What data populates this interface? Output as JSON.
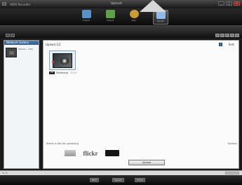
{
  "window": {
    "title": "Upload",
    "left_text": "HDRI Recorder",
    "controls": [
      "_",
      "□",
      "×"
    ]
  },
  "toolbar": {
    "modes": [
      {
        "label": "Import",
        "icon": "film-icon",
        "color": "#5a8fc8"
      },
      {
        "label": "Import",
        "icon": "camera-icon",
        "color": "#5fa04a"
      },
      {
        "label": "Disc",
        "icon": "disc-icon",
        "color": "#c89a3a"
      },
      {
        "label": "Upload",
        "icon": "upload-icon",
        "color": "#8fbbe6"
      }
    ]
  },
  "left_panel": {
    "header": "Network Gallery",
    "item_text": "Upload · 1 file"
  },
  "main": {
    "title": "Upload 1/2",
    "right_label": "Sort",
    "card": {
      "name": "Skydiving",
      "time": "0:14"
    },
    "upload_prompt": "Select a site for uploading",
    "upload_right": "Options",
    "sites": [
      "",
      "flickr",
      "",
      ""
    ],
    "upload_button": "Upload"
  },
  "status": {
    "left": "1 / 1"
  },
  "bottom": {
    "buttons": [
      "Back",
      "Upload",
      "Home"
    ]
  }
}
